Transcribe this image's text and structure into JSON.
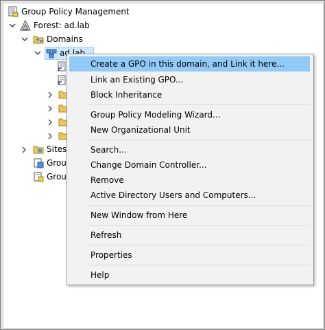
{
  "tree": {
    "root": "Group Policy Management",
    "forest": "Forest: ad.lab",
    "domains": "Domains",
    "domain": "ad.lab",
    "sites": "Sites",
    "gpm1": "Grou",
    "gpm2": "Grou"
  },
  "menu": {
    "create_gpo": "Create a GPO in this domain, and Link it here...",
    "link_gpo": "Link an Existing GPO...",
    "block_inheritance": "Block Inheritance",
    "modeling_wizard": "Group Policy Modeling Wizard...",
    "new_ou": "New Organizational Unit",
    "search": "Search...",
    "change_dc": "Change Domain Controller...",
    "remove": "Remove",
    "aduc": "Active Directory Users and Computers...",
    "new_window": "New Window from Here",
    "refresh": "Refresh",
    "properties": "Properties",
    "help": "Help"
  },
  "colors": {
    "menu_highlight": "#91c9f7",
    "selection": "#cce8ff",
    "menu_bg": "#f2f2f2"
  },
  "icons": [
    "gpm-root-icon",
    "forest-icon",
    "domains-folder-icon",
    "domain-icon",
    "gpo-link-icon",
    "folder-icon",
    "sites-icon",
    "modeling-icon",
    "results-icon",
    "chevron-down-icon",
    "chevron-right-icon"
  ]
}
